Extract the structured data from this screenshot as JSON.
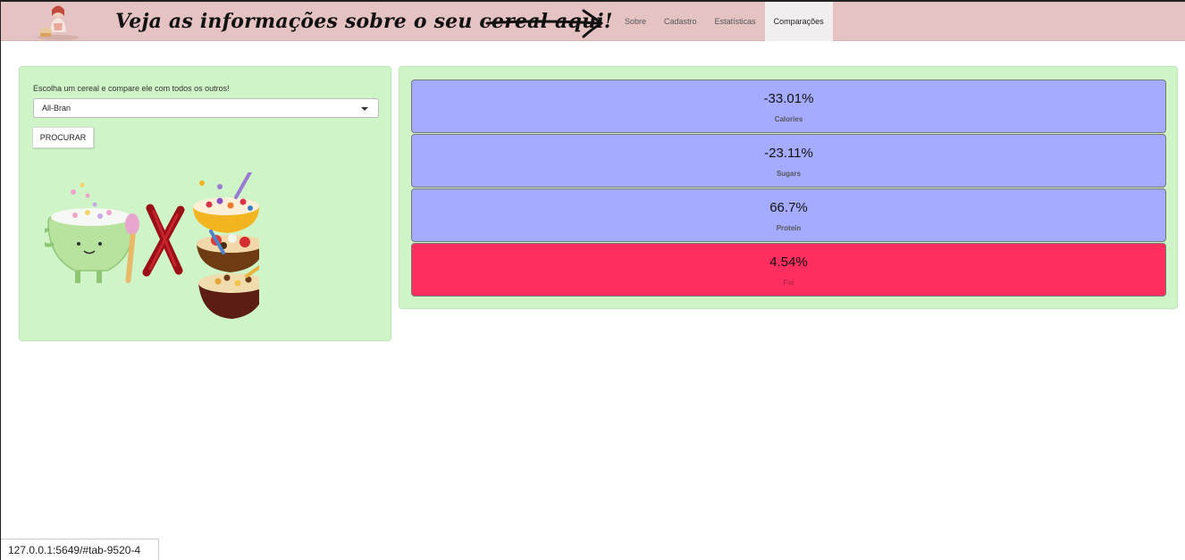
{
  "header": {
    "banner_text": "Veja as informações sobre o seu cereal aqui!",
    "background_color": "#e6c3c3",
    "logo_icon": "woman-eating-cereal-logo",
    "arrow_icon": "hand-drawn-arrow-right-icon"
  },
  "nav": {
    "tabs": [
      {
        "label": "Sobre",
        "active": false
      },
      {
        "label": "Cadastro",
        "active": false
      },
      {
        "label": "Estatísticas",
        "active": false
      },
      {
        "label": "Comparações",
        "active": true
      }
    ]
  },
  "left_panel": {
    "prompt": "Escolha um cereal e compare ele com todos os outros!",
    "select": {
      "value": "All-Bran",
      "icon": "caret-down-icon"
    },
    "search_button": "PROCURAR",
    "illustration": "cereal-bowls-vs-illustration",
    "background_color": "#cef4c7"
  },
  "results": [
    {
      "value": "-33.01%",
      "label": "Calories",
      "color": "#a5acff"
    },
    {
      "value": "-23.11%",
      "label": "Sugars",
      "color": "#a5acff"
    },
    {
      "value": "66.7%",
      "label": "Protein",
      "color": "#a5acff"
    },
    {
      "value": "4.54%",
      "label": "Fat",
      "color": "#ff2e5e"
    }
  ],
  "status_bar": {
    "url": "127.0.0.1:5649/#tab-9520-4"
  }
}
